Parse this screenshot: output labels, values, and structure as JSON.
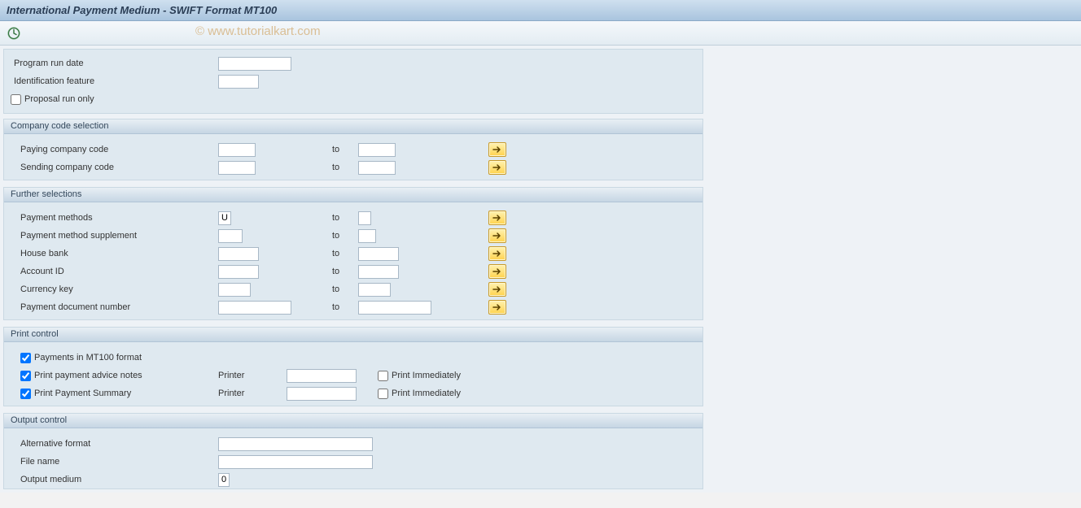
{
  "title": "International Payment Medium - SWIFT Format MT100",
  "watermark": "© www.tutorialkart.com",
  "top": {
    "program_run_date_label": "Program run date",
    "program_run_date_value": "",
    "ident_label": "Identification feature",
    "ident_value": "",
    "proposal_label": "Proposal run only",
    "proposal_checked": false
  },
  "company": {
    "header": "Company code selection",
    "pay_label": "Paying company code",
    "send_label": "Sending company code",
    "to_word": "to",
    "pay_from": "",
    "pay_to": "",
    "send_from": "",
    "send_to": ""
  },
  "further": {
    "header": "Further selections",
    "to_word": "to",
    "pm_label": "Payment methods",
    "pm_from": "U",
    "pm_to": "",
    "pms_label": "Payment method supplement",
    "pms_from": "",
    "pms_to": "",
    "hb_label": "House bank",
    "hb_from": "",
    "hb_to": "",
    "acc_label": "Account ID",
    "acc_from": "",
    "acc_to": "",
    "ck_label": "Currency key",
    "ck_from": "",
    "ck_to": "",
    "dn_label": "Payment document number",
    "dn_from": "",
    "dn_to": ""
  },
  "print": {
    "header": "Print control",
    "mt100_label": "Payments in MT100 format",
    "mt100_checked": true,
    "advice_label": "Print payment advice notes",
    "advice_checked": true,
    "summary_label": "Print Payment Summary",
    "summary_checked": true,
    "printer_word": "Printer",
    "printer1": "",
    "printer2": "",
    "print_imm_label": "Print Immediately",
    "imm1_checked": false,
    "imm2_checked": false
  },
  "output": {
    "header": "Output control",
    "alt_label": "Alternative format",
    "alt_value": "",
    "file_label": "File name",
    "file_value": "",
    "medium_label": "Output medium",
    "medium_value": "0"
  }
}
